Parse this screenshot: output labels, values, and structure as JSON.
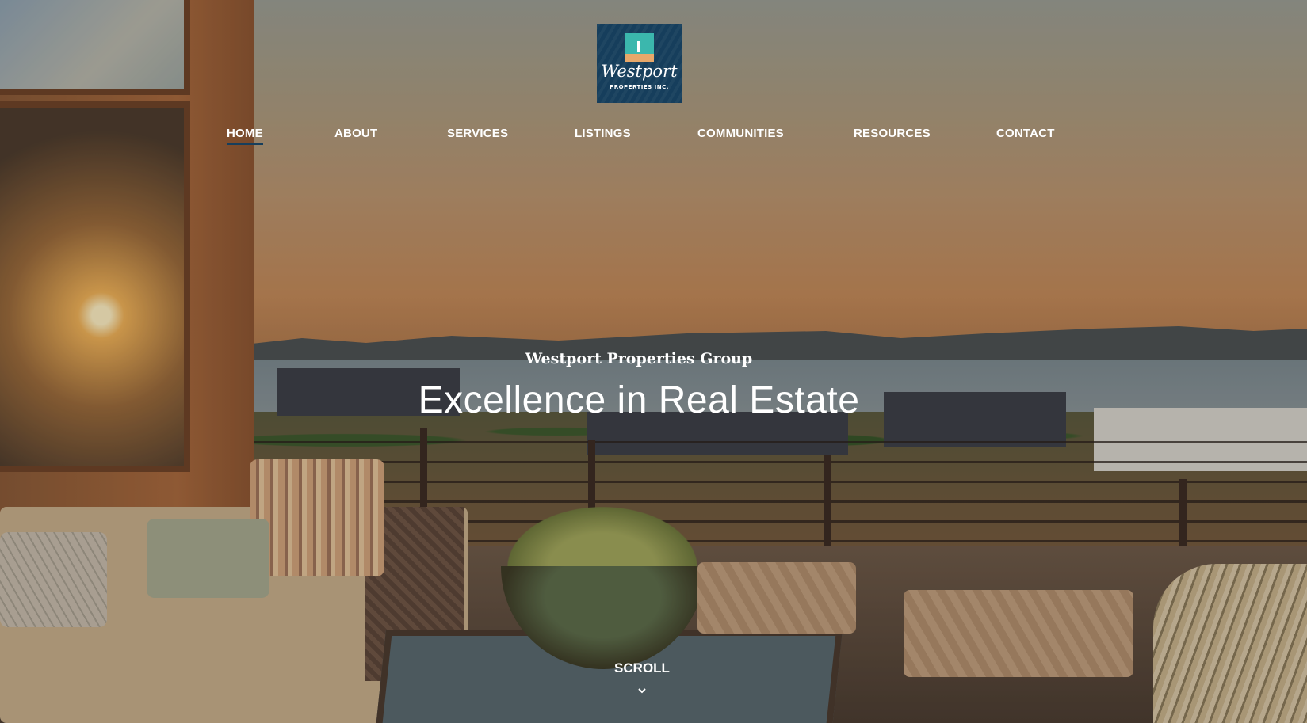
{
  "logo": {
    "name": "Westport",
    "sub": "PROPERTIES INC."
  },
  "nav": {
    "items": [
      {
        "label": "HOME",
        "active": true
      },
      {
        "label": "ABOUT",
        "active": false
      },
      {
        "label": "SERVICES",
        "active": false
      },
      {
        "label": "LISTINGS",
        "active": false
      },
      {
        "label": "COMMUNITIES",
        "active": false
      },
      {
        "label": "RESOURCES",
        "active": false
      },
      {
        "label": "CONTACT",
        "active": false
      }
    ]
  },
  "hero": {
    "subtitle": "Westport Properties Group",
    "title": "Excellence in Real Estate",
    "scroll_label": "SCROLL",
    "scroll_icon": "chevron-down-icon"
  },
  "colors": {
    "brand_navy": "#163e5c",
    "brand_teal": "#3bb7ad",
    "brand_sand": "#e8a86a",
    "text": "#ffffff"
  }
}
